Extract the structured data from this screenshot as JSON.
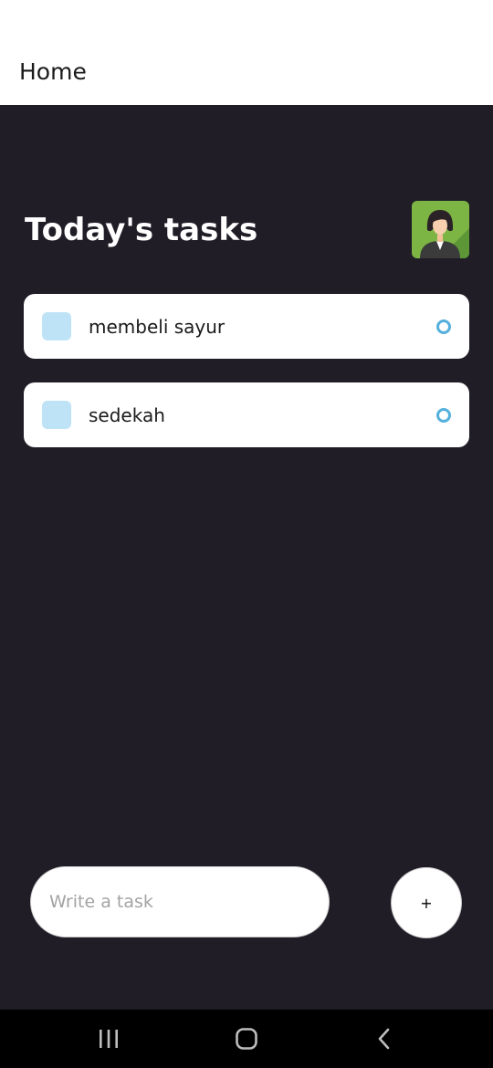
{
  "app_bar": {
    "title": "Home"
  },
  "screen": {
    "title": "Today's tasks"
  },
  "tasks": [
    {
      "label": "membeli sayur"
    },
    {
      "label": "sedekah"
    }
  ],
  "composer": {
    "placeholder": "Write a task",
    "add_label": "+"
  },
  "colors": {
    "background": "#201d27",
    "card": "#ffffff",
    "task_square": "#bfe3f6",
    "task_circle": "#55b0dc"
  },
  "icons": {
    "avatar": "woman-avatar",
    "nav_recent": "recent-apps-icon",
    "nav_home": "home-icon",
    "nav_back": "back-icon"
  }
}
